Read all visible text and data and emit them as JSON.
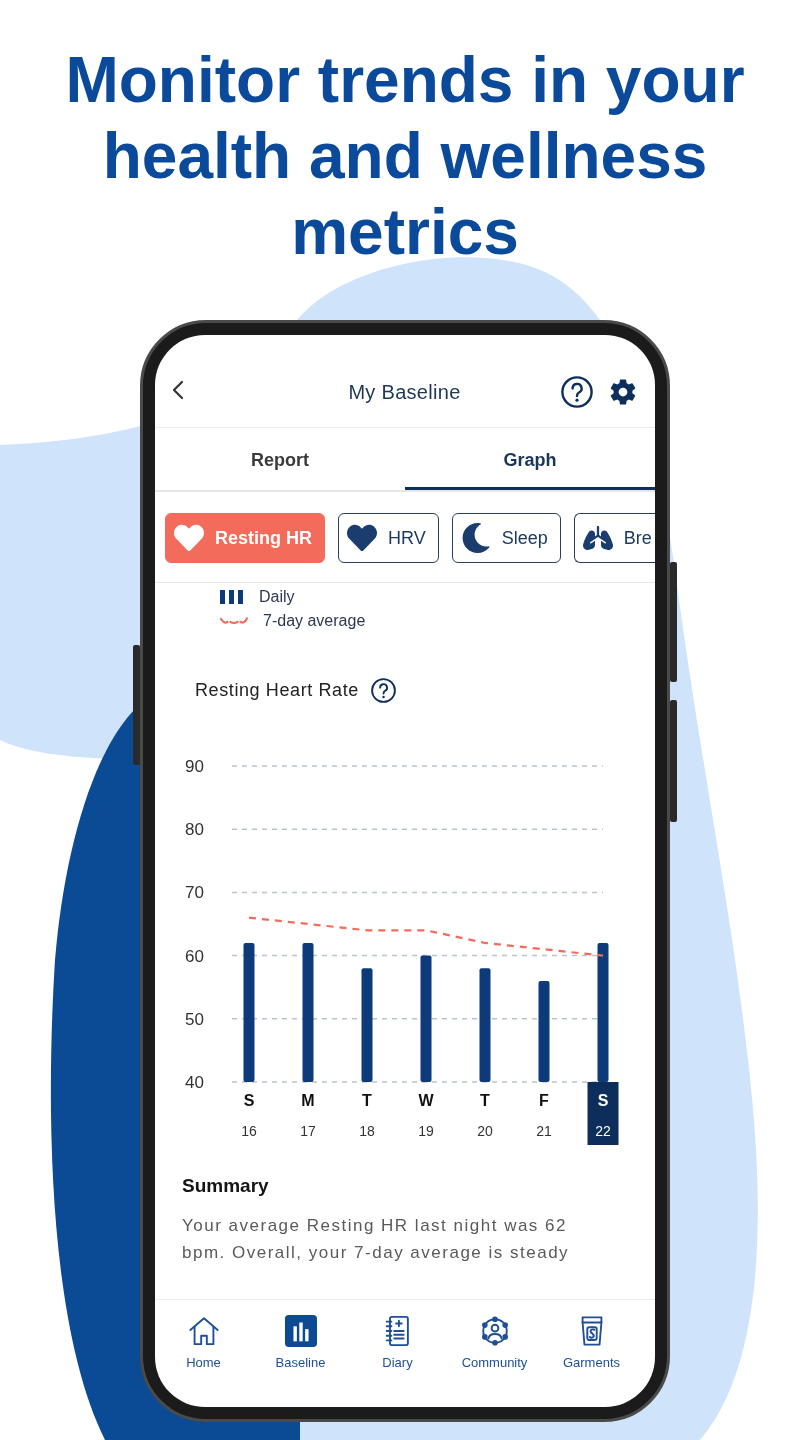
{
  "headline": "Monitor trends in your health and wellness metrics",
  "header": {
    "title": "My Baseline"
  },
  "tabs": [
    {
      "label": "Report",
      "selected": false
    },
    {
      "label": "Graph",
      "selected": true
    }
  ],
  "metric_chips": [
    {
      "label": "Resting HR",
      "selected": true
    },
    {
      "label": "HRV",
      "selected": false
    },
    {
      "label": "Sleep",
      "selected": false
    },
    {
      "label": "Bre",
      "selected": false
    }
  ],
  "chart": {
    "dates": [
      {
        "label": "16",
        "selected": false
      },
      {
        "label": "17",
        "selected": false
      },
      {
        "label": "18",
        "selected": false
      },
      {
        "label": "19",
        "selected": false
      },
      {
        "label": "20",
        "selected": false
      },
      {
        "label": "21",
        "selected": false
      },
      {
        "label": "22",
        "selected": true
      }
    ],
    "chart_data": {
      "type": "bar",
      "title": "Resting Heart Rate",
      "categories": [
        "S",
        "M",
        "T",
        "W",
        "T",
        "F",
        "S"
      ],
      "series": [
        {
          "name": "Daily",
          "type": "bar",
          "color": "#0d3b7a",
          "values": [
            62,
            62,
            58,
            60,
            58,
            56,
            62
          ]
        },
        {
          "name": "7-day average",
          "type": "line",
          "line_style": "dashed",
          "color": "#f26b5b",
          "values": [
            66,
            65,
            64,
            64,
            62,
            61,
            60
          ]
        }
      ],
      "ylim": [
        40,
        90
      ],
      "yticks": [
        40,
        50,
        60,
        70,
        80,
        90
      ],
      "grid": true
    }
  },
  "summary": {
    "title": "Summary",
    "text": "Your average Resting HR last night was 62 bpm. Overall, your 7-day average is steady"
  },
  "nav": [
    {
      "label": "Home",
      "selected": false
    },
    {
      "label": "Baseline",
      "selected": true
    },
    {
      "label": "Diary",
      "selected": false
    },
    {
      "label": "Community",
      "selected": false
    },
    {
      "label": "Garments",
      "selected": false
    }
  ]
}
